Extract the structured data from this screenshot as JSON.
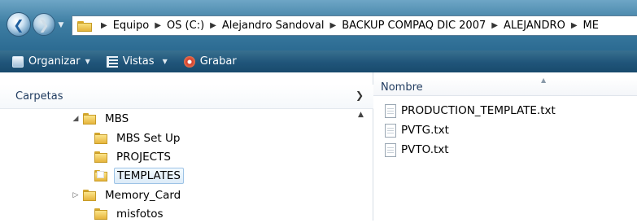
{
  "address_bar": {
    "breadcrumbs": [
      "Equipo",
      "OS (C:)",
      "Alejandro Sandoval",
      "BACKUP COMPAQ DIC 2007",
      "ALEJANDRO",
      "ME"
    ]
  },
  "toolbar": {
    "organize_label": "Organizar",
    "views_label": "Vistas",
    "burn_label": "Grabar"
  },
  "nav_pane": {
    "title": "Carpetas",
    "items": [
      {
        "label": "MBS",
        "expander": "expanded"
      },
      {
        "label": "MBS Set Up",
        "expander": "none"
      },
      {
        "label": "PROJECTS",
        "expander": "none"
      },
      {
        "label": "TEMPLATES",
        "expander": "none",
        "selected": true
      },
      {
        "label": "Memory_Card",
        "expander": "collapsed"
      },
      {
        "label": "misfotos",
        "expander": "none"
      }
    ]
  },
  "file_list": {
    "column_header": "Nombre",
    "files": [
      {
        "name": "PRODUCTION_TEMPLATE.txt"
      },
      {
        "name": "PVTG.txt"
      },
      {
        "name": "PVTO.txt"
      }
    ]
  },
  "colors": {
    "titlebar_top": "#6ea6c6",
    "toolbar": "#20557a",
    "folder_yellow": "#f8df7c",
    "selection": "#dcebf8",
    "header_text": "#1e3a5f"
  },
  "icons": {
    "back": "back-arrow-icon",
    "forward": "forward-arrow-icon",
    "folder": "folder-icon",
    "file": "text-file-icon"
  }
}
